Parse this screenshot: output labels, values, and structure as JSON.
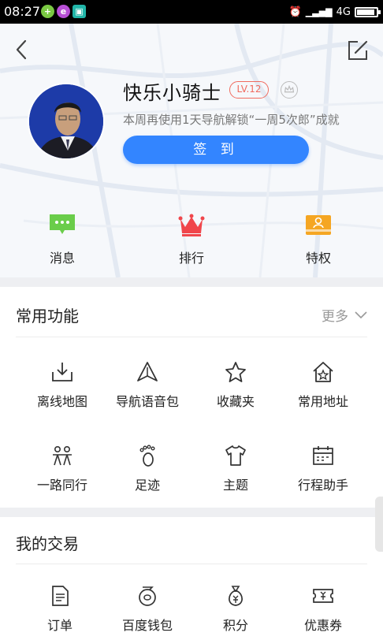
{
  "status_bar": {
    "time": "08:27",
    "network": "4G",
    "signal_label": "4G",
    "battery_percent": 90
  },
  "profile": {
    "name": "快乐小骑士",
    "level": "LV.12",
    "hint": "本周再使用1天导航解锁“一周5次郎”成就",
    "checkin_label": "签 到"
  },
  "quick_actions": [
    {
      "label": "消息",
      "icon": "message-icon"
    },
    {
      "label": "排行",
      "icon": "crown-icon"
    },
    {
      "label": "特权",
      "icon": "vip-card-icon"
    }
  ],
  "common": {
    "title": "常用功能",
    "more_label": "更多",
    "items": [
      {
        "label": "离线地图",
        "icon": "download-tray-icon"
      },
      {
        "label": "导航语音包",
        "icon": "navigation-arrow-icon"
      },
      {
        "label": "收藏夹",
        "icon": "star-icon"
      },
      {
        "label": "常用地址",
        "icon": "home-star-icon"
      },
      {
        "label": "一路同行",
        "icon": "people-icon"
      },
      {
        "label": "足迹",
        "icon": "footprint-icon"
      },
      {
        "label": "主题",
        "icon": "tshirt-icon"
      },
      {
        "label": "行程助手",
        "icon": "calendar-icon"
      }
    ]
  },
  "trade": {
    "title": "我的交易",
    "items": [
      {
        "label": "订单",
        "icon": "document-icon"
      },
      {
        "label": "百度钱包",
        "icon": "wallet-icon"
      },
      {
        "label": "积分",
        "icon": "money-bag-icon"
      },
      {
        "label": "优惠券",
        "icon": "coupon-icon"
      }
    ]
  },
  "colors": {
    "accent_blue": "#3385ff",
    "level_red": "#f06b5f",
    "crown_red": "#f0464b",
    "vip_orange": "#f5a623",
    "message_green": "#6acd4a"
  }
}
